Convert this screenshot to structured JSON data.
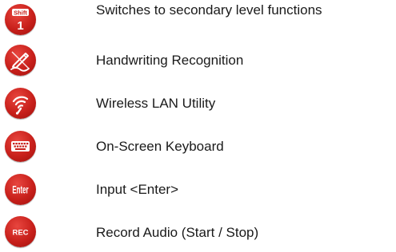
{
  "rows": [
    {
      "icon": "shift-key-icon",
      "label": "Switches to secondary level functions",
      "badge_top": "Shift",
      "badge_bottom": "1"
    },
    {
      "icon": "handwriting-pen-icon",
      "label": "Handwriting Recognition"
    },
    {
      "icon": "wireless-lan-icon",
      "label": "Wireless LAN Utility"
    },
    {
      "icon": "keyboard-icon",
      "label": "On-Screen Keyboard"
    },
    {
      "icon": "enter-key-icon",
      "label": "Input <Enter>",
      "badge": "Enter"
    },
    {
      "icon": "record-audio-icon",
      "label": "Record Audio (Start / Stop)",
      "badge": "REC"
    }
  ],
  "colors": {
    "icon_red": "#c8201b",
    "icon_symbol": "#ffffff",
    "text": "#1a1a1a"
  }
}
